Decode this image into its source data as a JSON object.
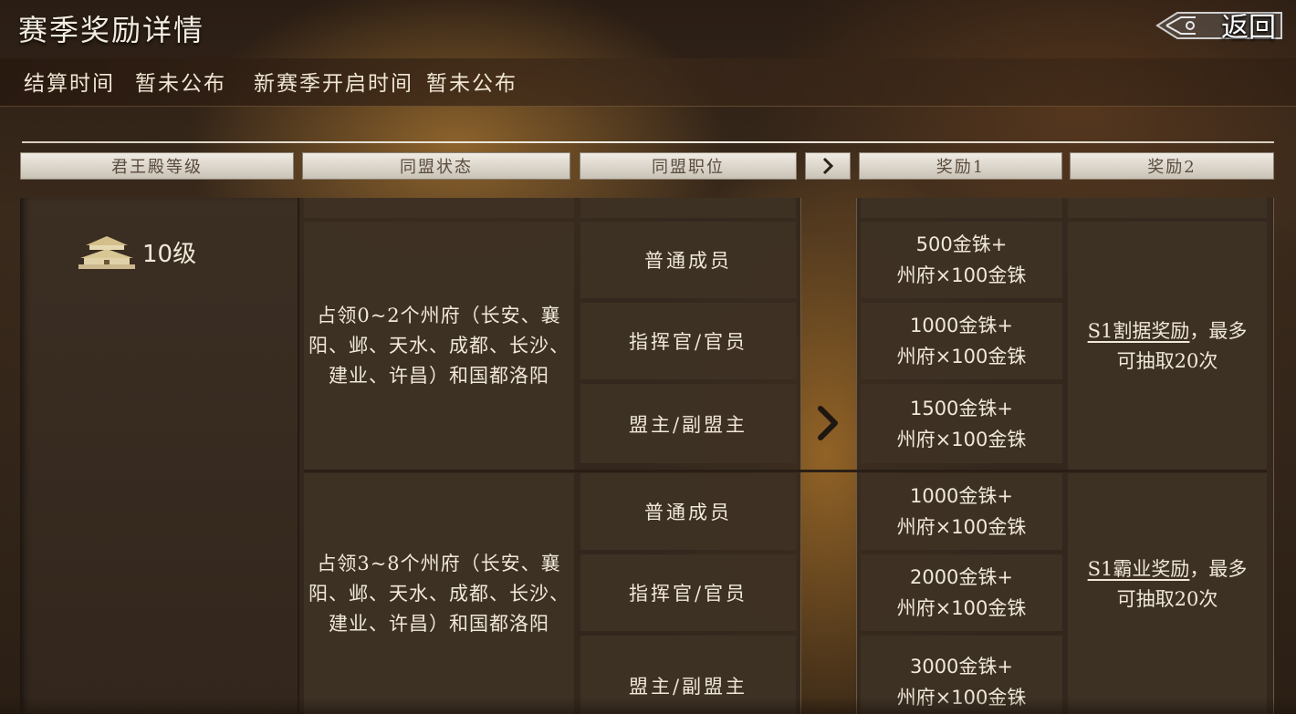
{
  "header": {
    "title": "赛季奖励详情",
    "back_label": "返回"
  },
  "times": {
    "settle_label": "结算时间",
    "settle_value": "暂未公布",
    "new_season_label": "新赛季开启时间",
    "new_season_value": "暂未公布"
  },
  "columns": {
    "level": "君王殿等级",
    "alliance_status": "同盟状态",
    "alliance_role": "同盟职位",
    "reward1": "奖励1",
    "reward2": "奖励2"
  },
  "level": {
    "text": "10级",
    "icon": "palace-icon"
  },
  "groups": [
    {
      "status": "占领0~2个州府（长安、襄阳、邺、天水、成都、长沙、建业、许昌）和国都洛阳",
      "reward2_link": "S1割据奖励",
      "reward2_rest": "，最多",
      "reward2_line2": "可抽取20次",
      "rows": [
        {
          "role": "普通成员",
          "reward_line1": "500金铢+",
          "reward_line2": "州府×100金铢"
        },
        {
          "role": "指挥官/官员",
          "reward_line1": "1000金铢+",
          "reward_line2": "州府×100金铢"
        },
        {
          "role": "盟主/副盟主",
          "reward_line1": "1500金铢+",
          "reward_line2": "州府×100金铢"
        }
      ]
    },
    {
      "status": "占领3~8个州府（长安、襄阳、邺、天水、成都、长沙、建业、许昌）和国都洛阳",
      "reward2_link": "S1霸业奖励",
      "reward2_rest": "，最多",
      "reward2_line2": "可抽取20次",
      "rows": [
        {
          "role": "普通成员",
          "reward_line1": "1000金铢+",
          "reward_line2": "州府×100金铢"
        },
        {
          "role": "指挥官/官员",
          "reward_line1": "2000金铢+",
          "reward_line2": "州府×100金铢"
        },
        {
          "role": "盟主/副盟主",
          "reward_line1": "3000金铢+",
          "reward_line2": "州府×100金铢"
        }
      ]
    }
  ],
  "colors": {
    "header_tab_top": "#f0ebe3",
    "cell_bg": "#3e3125",
    "text": "#f0e8d8"
  }
}
